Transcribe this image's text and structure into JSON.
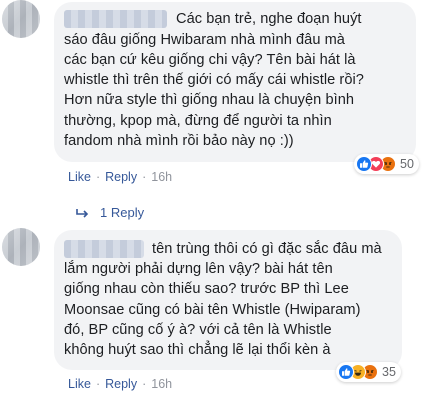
{
  "comments": [
    {
      "text_lines": [
        "Các bạn trẻ, nghe đoạn huýt",
        "sáo đâu giống Hwibaram nhà mình đâu mà",
        "các bạn cứ kêu giống chi vậy? Tên bài hát là",
        "whistle thì trên thế giới có mấy cái whistle rồi?",
        "Hơn nữa style thì giống nhau là chuyện bình",
        "thường, kpop mà, đừng để người ta nhìn",
        "fandom nhà mình rồi bảo này nọ :))"
      ],
      "reactions": {
        "icons": [
          "like-icon",
          "love-icon",
          "angry-icon"
        ],
        "count": "50"
      },
      "actions": {
        "like": "Like",
        "reply": "Reply",
        "time": "16h"
      },
      "replies_label": "1 Reply"
    },
    {
      "text_lines": [
        "tên trùng thôi có gì đặc sắc đâu mà",
        "lắm người phải dựng lên vậy? bài hát tên",
        "giống nhau còn thiếu sao? trước BP thì Lee",
        "Moonsae cũng có bài tên Whistle (Hwiparam)",
        "đó, BP cũng cố ý à? với cả tên là Whistle",
        "không huýt sao thì chẳng lẽ lại thổi kèn à"
      ],
      "reactions": {
        "icons": [
          "like-icon",
          "haha-icon",
          "angry-icon"
        ],
        "count": "35"
      },
      "actions": {
        "like": "Like",
        "reply": "Reply",
        "time": "16h"
      }
    }
  ],
  "colors": {
    "bubble": "#f2f3f5",
    "link": "#365899",
    "meta": "#90949c",
    "text": "#1c1e21"
  }
}
